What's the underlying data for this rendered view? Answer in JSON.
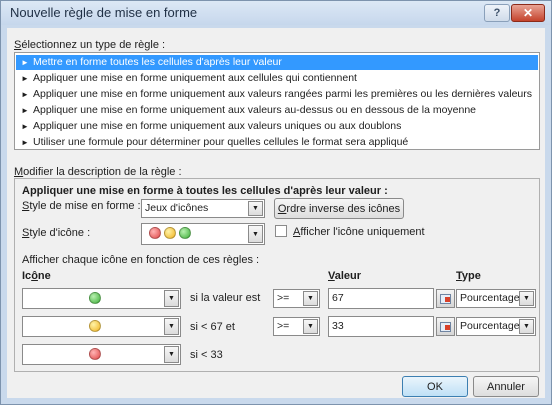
{
  "window": {
    "title": "Nouvelle règle de mise en forme",
    "help_glyph": "?",
    "close_glyph": "✕"
  },
  "rule_types": {
    "label_underlined": "S",
    "label_rest": "électionnez un type de règle :",
    "items": [
      "Mettre en forme toutes les cellules d'après leur valeur",
      "Appliquer une mise en forme uniquement aux cellules qui contiennent",
      "Appliquer une mise en forme uniquement aux valeurs rangées parmi les premières ou les dernières valeurs",
      "Appliquer une mise en forme uniquement aux valeurs au-dessus ou en dessous de la moyenne",
      "Appliquer une mise en forme uniquement aux valeurs uniques ou aux doublons",
      "Utiliser une formule pour déterminer pour quelles cellules le format sera appliqué"
    ],
    "selected_index": 0,
    "arrow": "►"
  },
  "description": {
    "label_underlined": "M",
    "label_rest": "odifier la description de la règle :",
    "heading": "Appliquer une mise en forme à toutes les cellules d'après leur valeur :",
    "style_label_u": "S",
    "style_label_rest": "tyle de mise en forme :",
    "style_value": "Jeux d'icônes",
    "reverse_u": "O",
    "reverse_rest": "rdre inverse des icônes",
    "icon_style_label_u": "S",
    "icon_style_label_rest": "tyle d'icône :",
    "show_icon_only_u": "A",
    "show_icon_only_rest": "fficher l'icône uniquement",
    "show_icon_only_checked": false,
    "rules_heading": "Afficher chaque icône en fonction de ces règles :",
    "col_icon_u1": "Ic",
    "col_icon_u": "ô",
    "col_icon_rest": "ne",
    "col_value_u": "V",
    "col_value_rest": "aleur",
    "col_type_u": "T",
    "col_type_rest": "ype",
    "rows": [
      {
        "icon": "green-circle",
        "condition": "si la valeur est",
        "operator": ">=",
        "value": "67",
        "type": "Pourcentage"
      },
      {
        "icon": "yellow-circle",
        "condition": "si < 67 et",
        "operator": ">=",
        "value": "33",
        "type": "Pourcentage"
      },
      {
        "icon": "red-circle",
        "condition": "si < 33"
      }
    ]
  },
  "buttons": {
    "ok": "OK",
    "cancel": "Annuler"
  },
  "colors": {
    "selection": "#3399ff",
    "red": "#e04545",
    "yellow": "#f0b21e",
    "green": "#3cae36"
  }
}
